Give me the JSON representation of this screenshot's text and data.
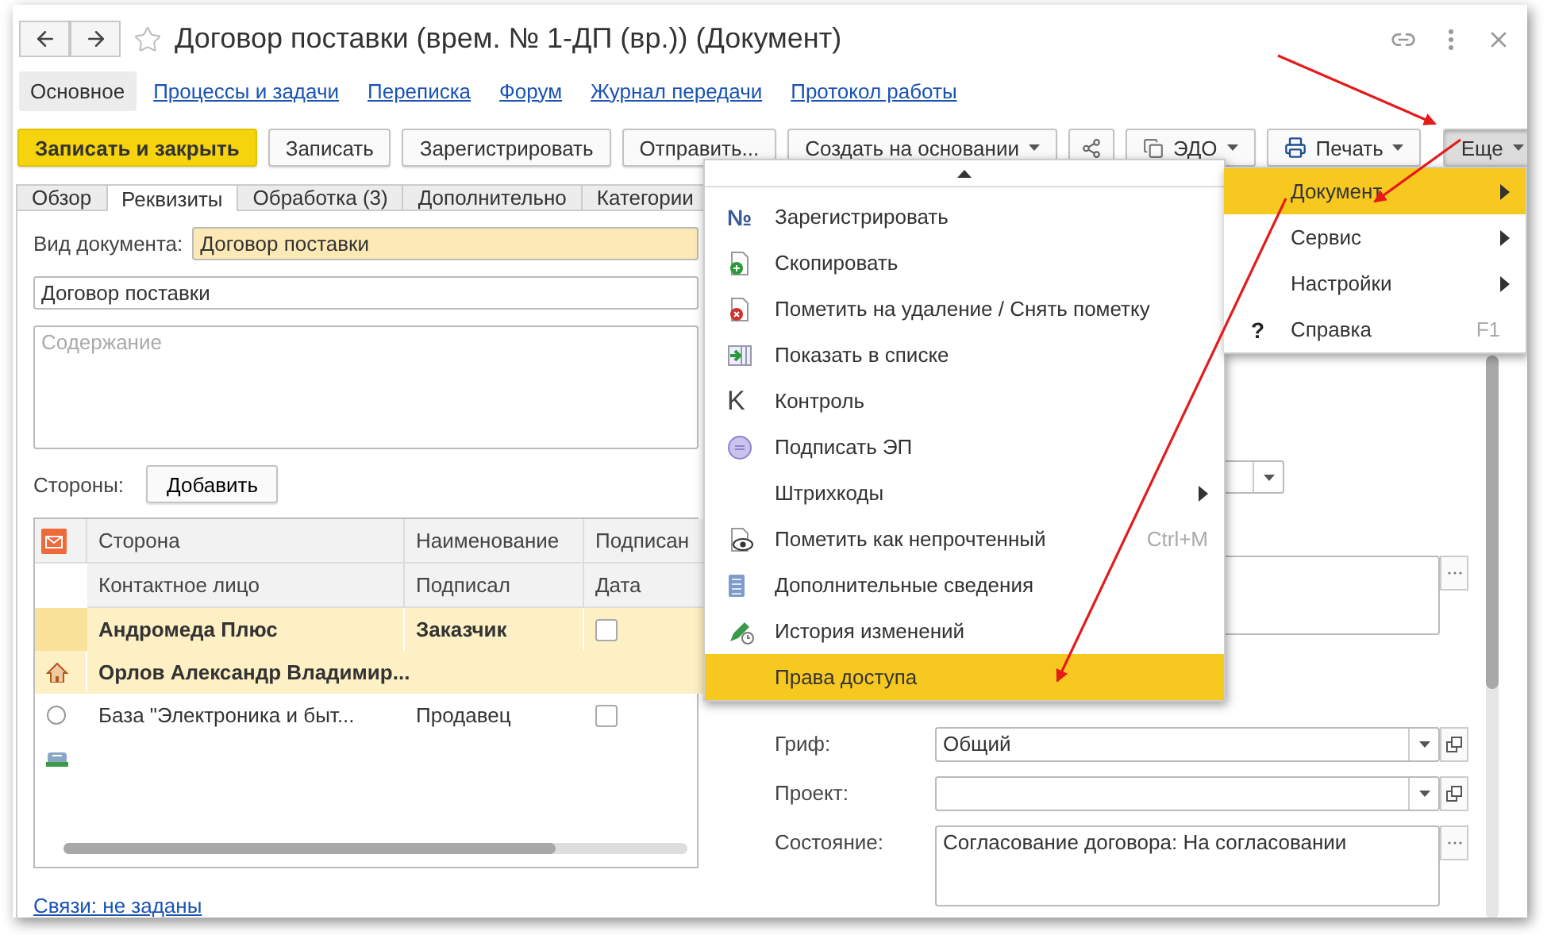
{
  "window": {
    "title": "Договор поставки (врем. № 1-ДП (вр.)) (Документ)"
  },
  "sections": [
    {
      "label": "Основное",
      "selected": true
    },
    {
      "label": "Процессы и задачи",
      "selected": false
    },
    {
      "label": "Переписка",
      "selected": false
    },
    {
      "label": "Форум",
      "selected": false
    },
    {
      "label": "Журнал передачи",
      "selected": false
    },
    {
      "label": "Протокол работы",
      "selected": false
    }
  ],
  "toolbar": [
    {
      "label": "Записать и закрыть",
      "kind": "primary"
    },
    {
      "label": "Записать",
      "kind": "plain"
    },
    {
      "label": "Зарегистрировать",
      "kind": "plain"
    },
    {
      "label": "Отправить...",
      "kind": "plain"
    },
    {
      "label": "Создать на основании",
      "kind": "dropdown"
    },
    {
      "kind": "share"
    },
    {
      "label": "ЭДО",
      "kind": "edo"
    },
    {
      "label": "Печать",
      "kind": "print"
    },
    {
      "label": "Еще",
      "kind": "more",
      "pressed": true
    }
  ],
  "tabs": [
    {
      "label": "Обзор",
      "selected": false
    },
    {
      "label": "Реквизиты",
      "selected": true
    },
    {
      "label": "Обработка (3)",
      "selected": false
    },
    {
      "label": "Дополнительно",
      "selected": false
    },
    {
      "label": "Категории",
      "selected": false
    }
  ],
  "doc_type": {
    "label": "Вид документа:",
    "value": "Договор поставки"
  },
  "name_field": {
    "value": "Договор поставки"
  },
  "content_field": {
    "placeholder": "Содержание"
  },
  "parties": {
    "label": "Стороны:",
    "add_button": "Добавить",
    "columns": [
      [
        "Сторона",
        "Контактное лицо"
      ],
      [
        "Наименование",
        "Подписал"
      ],
      [
        "Подписан",
        "Дата"
      ]
    ],
    "rows": [
      {
        "selected": true,
        "party": "Андромеда Плюс",
        "contact": "Орлов Александр Владимир...",
        "role": "Заказчик",
        "signed": false
      },
      {
        "selected": false,
        "party": "База \"Электроника и быт...",
        "role": "Продавец",
        "signed": false
      }
    ]
  },
  "links": "Связи: не заданы",
  "right_fields": [
    {
      "label": "Гриф:",
      "value": "Общий",
      "kind": "combo"
    },
    {
      "label": "Проект:",
      "kind": "combo"
    },
    {
      "label": "Состояние:",
      "value": "Согласование договора: На согласовании",
      "kind": "text"
    }
  ],
  "menu": [
    {
      "label": "Зарегистрировать",
      "glyph": "№",
      "selected": false
    },
    {
      "label": "Скопировать",
      "selected": false
    },
    {
      "label": "Пометить на удаление / Снять пометку",
      "selected": false
    },
    {
      "label": "Показать в списке",
      "selected": false
    },
    {
      "label": "Контроль",
      "glyph": "K",
      "selected": false
    },
    {
      "label": "Подписать ЭП",
      "selected": false
    },
    {
      "label": "Штрихкоды",
      "submenu": true,
      "selected": false
    },
    {
      "label": "Пометить как непрочтенный",
      "shortcut": "Ctrl+M",
      "selected": false
    },
    {
      "label": "Дополнительные сведения",
      "selected": false
    },
    {
      "label": "История изменений",
      "selected": false
    },
    {
      "label": "Права доступа",
      "selected": true
    }
  ],
  "submenu": [
    {
      "label": "Документ",
      "submenu": true,
      "selected": true
    },
    {
      "label": "Сервис",
      "submenu": true,
      "selected": false
    },
    {
      "label": "Настройки",
      "submenu": true,
      "selected": false
    },
    {
      "label": "Справка",
      "glyph": "?",
      "shortcut": "F1",
      "selected": false
    }
  ]
}
